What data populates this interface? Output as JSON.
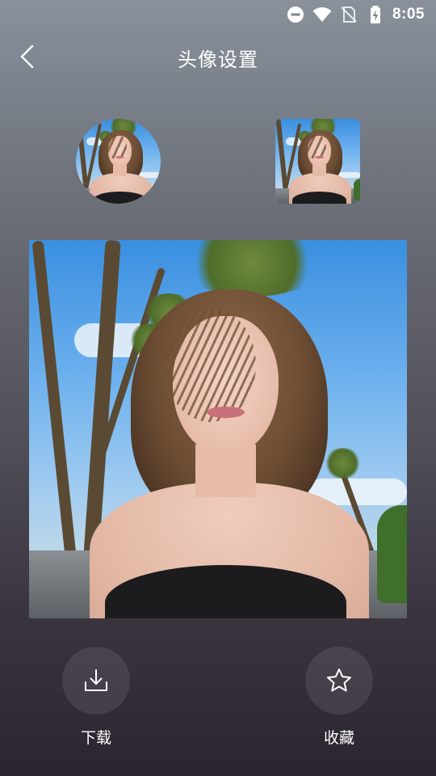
{
  "status_bar": {
    "time": "8:05",
    "icons": [
      "do-not-disturb-icon",
      "wifi-icon",
      "no-sim-icon",
      "battery-charging-icon"
    ]
  },
  "header": {
    "title": "头像设置",
    "back_icon": "back-arrow-icon"
  },
  "previews": {
    "circle_avatar": "circle-avatar-preview",
    "square_avatar": "square-avatar-preview"
  },
  "main_image": "avatar-photo",
  "actions": [
    {
      "label": "下载",
      "icon": "download-icon"
    },
    {
      "label": "收藏",
      "icon": "star-icon"
    }
  ]
}
